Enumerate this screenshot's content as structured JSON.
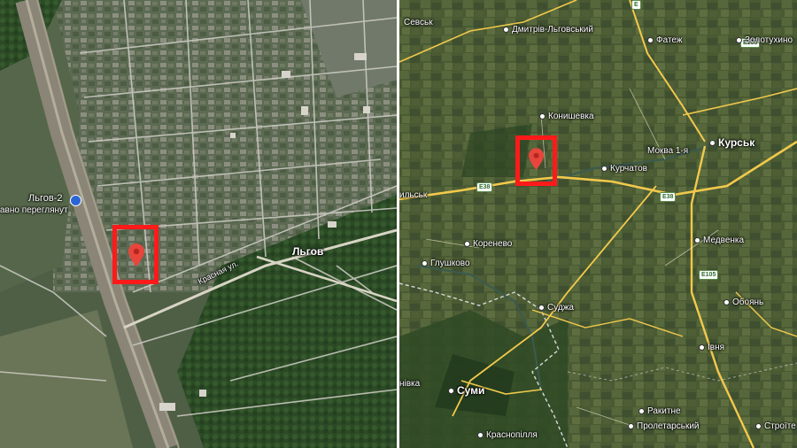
{
  "left_map": {
    "labels": {
      "lgov": "Льгов",
      "lgov2": "Льгов-2",
      "street": "Красная ул.",
      "recently_viewed": "авно переглянут"
    },
    "pin_icon": "map-pin-icon",
    "station_icon": "rail-station-icon"
  },
  "right_map": {
    "labels": {
      "sevsk": "Севськ",
      "dmitriev": "Дмитрів-Льговський",
      "fatezh": "Фатеж",
      "zolotukhino": "Золотухино",
      "konyshevka": "Конишевка",
      "kursk": "Курськ",
      "mokva": "Моква 1-я",
      "kurchatov": "Курчатов",
      "lgov_cut": "ильськ",
      "korenevo": "Коренево",
      "medvenka": "Медвенка",
      "glushkovo": "Глушково",
      "oboyan": "Обоянь",
      "sudzha": "Суджа",
      "ivnya": "Івня",
      "sumy": "Суми",
      "rakitnoe": "Ракитне",
      "proletarsky": "Пролетарський",
      "stroitel": "Строїте",
      "krasnopillya": "Краснопілля",
      "nivka": "нівка"
    },
    "shields": {
      "e38_left": "E38",
      "e38_right": "E38",
      "e105": "E105",
      "e105_top": "E105",
      "e_cut": "E"
    },
    "pin_icon": "map-pin-icon"
  },
  "colors": {
    "highlight": "#ff1a1a",
    "pin": "#e8453c",
    "road": "#f2c94c",
    "border": "#d9d9d9"
  }
}
